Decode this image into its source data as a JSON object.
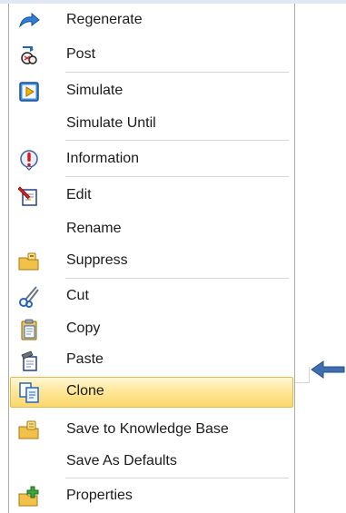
{
  "menu": {
    "items": [
      {
        "label": "Regenerate",
        "icon": "regenerate-icon"
      },
      {
        "label": "Post",
        "icon": "post-icon"
      },
      {
        "label": "Simulate",
        "icon": "simulate-icon"
      },
      {
        "label": "Simulate Until",
        "icon": ""
      },
      {
        "label": "Information",
        "icon": "information-icon"
      },
      {
        "label": "Edit",
        "icon": "edit-icon"
      },
      {
        "label": "Rename",
        "icon": ""
      },
      {
        "label": "Suppress",
        "icon": "suppress-icon"
      },
      {
        "label": "Cut",
        "icon": "cut-icon"
      },
      {
        "label": "Copy",
        "icon": "copy-icon"
      },
      {
        "label": "Paste",
        "icon": "paste-icon"
      },
      {
        "label": "Clone",
        "icon": "clone-icon",
        "highlighted": true
      },
      {
        "label": "Save to Knowledge Base",
        "icon": "save-knowledge-icon"
      },
      {
        "label": "Save As Defaults",
        "icon": ""
      },
      {
        "label": "Properties",
        "icon": "properties-icon"
      }
    ]
  },
  "colors": {
    "highlight": "#ffe79a",
    "highlight_border": "#e3b94d",
    "pointer_arrow": "#3f6fb0"
  }
}
